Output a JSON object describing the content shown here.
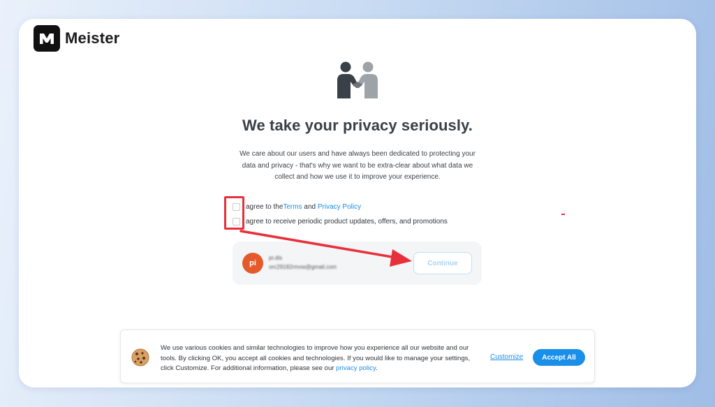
{
  "brand": {
    "name": "Meister",
    "logo_icon": "meister-m-icon"
  },
  "hero": {
    "icon": "handshake-people-icon",
    "headline": "We take your privacy seriously."
  },
  "intro": "We care about our users and have always been dedicated to protecting your data and privacy - that's why we want to be extra-clear about what data we collect and how we use it to improve your experience.",
  "consent": {
    "terms_prefix": "agree to the ",
    "terms_link": "Terms",
    "terms_and": " and ",
    "privacy_link": "Privacy Policy",
    "updates_label": "agree to receive periodic product updates, offers, and promotions"
  },
  "account": {
    "avatar_initials": "pi",
    "name": "pr.dis",
    "email": "orc29182rmvw@gmail.com",
    "continue_label": "Continue"
  },
  "cookie_banner": {
    "icon": "cookie-icon",
    "text": "We use various cookies and similar technologies to improve how you experience all our website and our tools. By clicking OK, you accept all cookies and technologies. If you would like to manage your settings, click Customize. For additional information, please see our ",
    "policy_link": "privacy policy",
    "text_end": ".",
    "customize_label": "Customize",
    "accept_label": "Accept All"
  },
  "colors": {
    "accent": "#1a8fe9",
    "annotation": "#e8303b",
    "avatar": "#e55a2b",
    "headline": "#3a4047"
  }
}
